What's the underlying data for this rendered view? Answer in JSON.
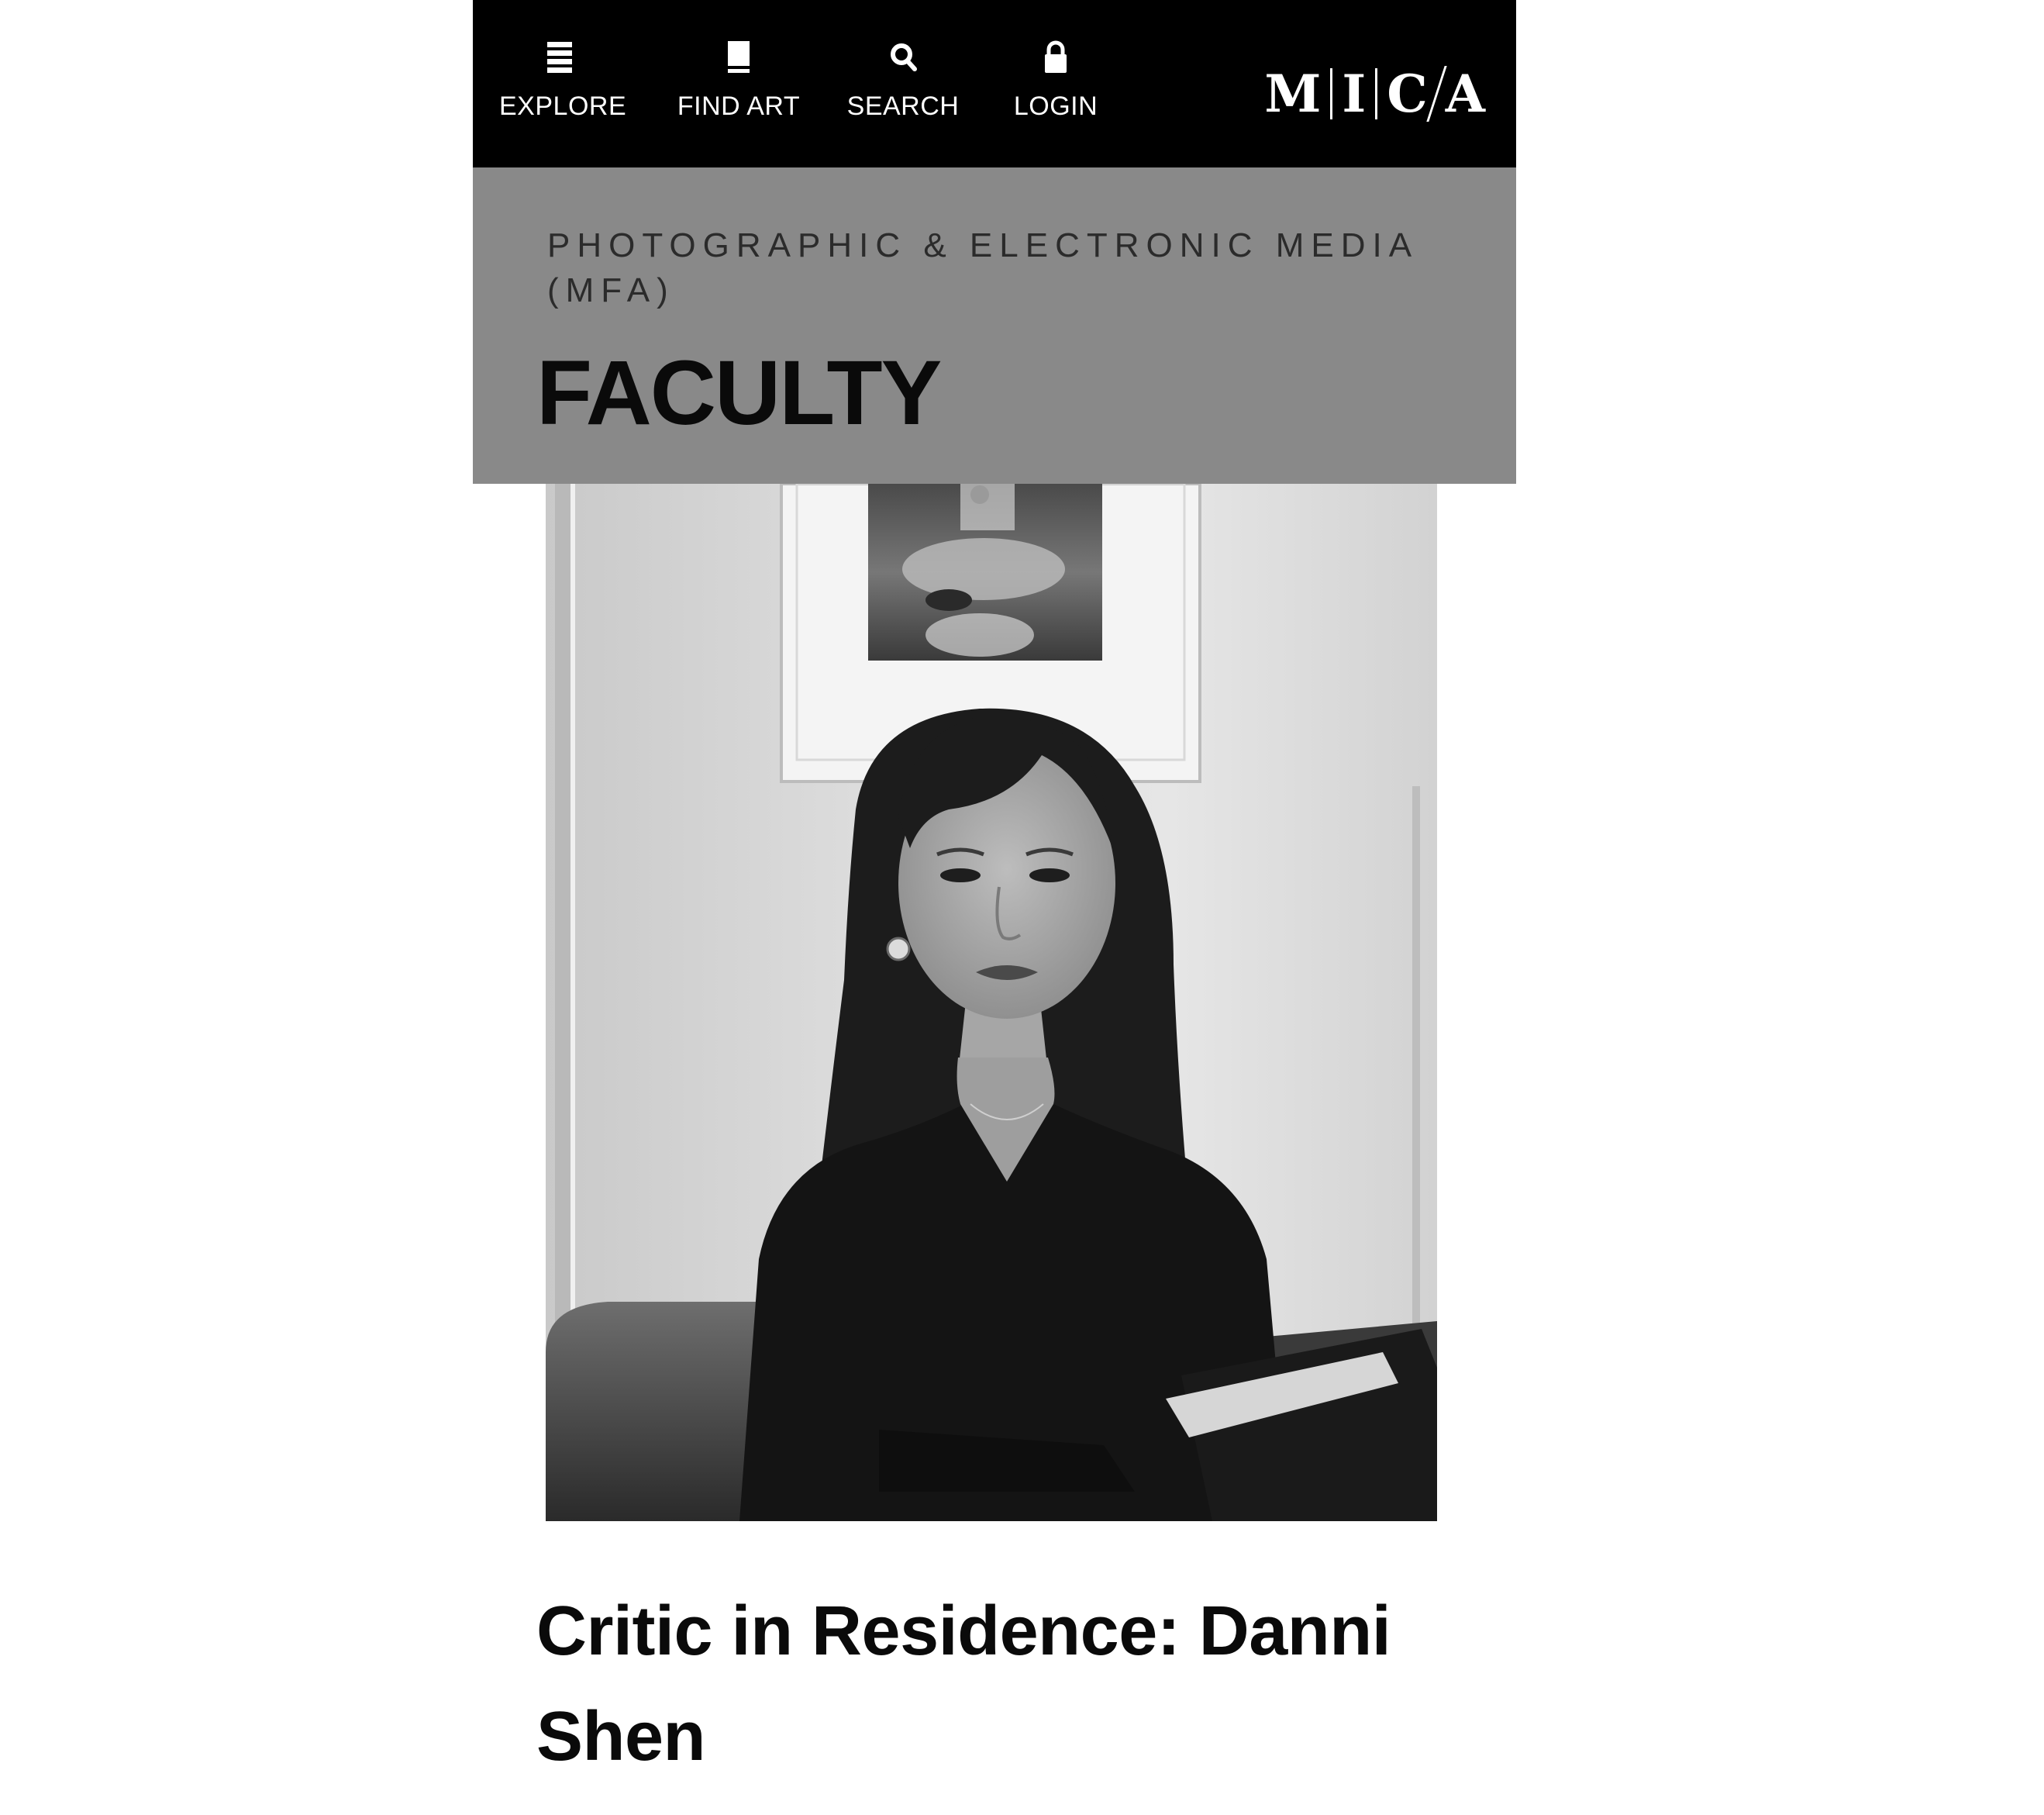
{
  "nav": {
    "items": [
      {
        "label": "EXPLORE",
        "icon": "menu-icon"
      },
      {
        "label": "FIND ART",
        "icon": "book-icon"
      },
      {
        "label": "SEARCH",
        "icon": "search-icon"
      },
      {
        "label": "LOGIN",
        "icon": "lock-icon"
      }
    ],
    "logo": {
      "letters": [
        "M",
        "I",
        "C",
        "A"
      ]
    }
  },
  "section": {
    "department": "PHOTOGRAPHIC & ELECTRONIC MEDIA (MFA)",
    "title": "FACULTY"
  },
  "article": {
    "headline": "Critic in Residence: Danni Shen"
  },
  "colors": {
    "nav_bg": "#000000",
    "nav_text": "#ffffff",
    "section_bg": "#898989",
    "text_dark": "#0a0a0a",
    "page_bg": "#ffffff"
  }
}
